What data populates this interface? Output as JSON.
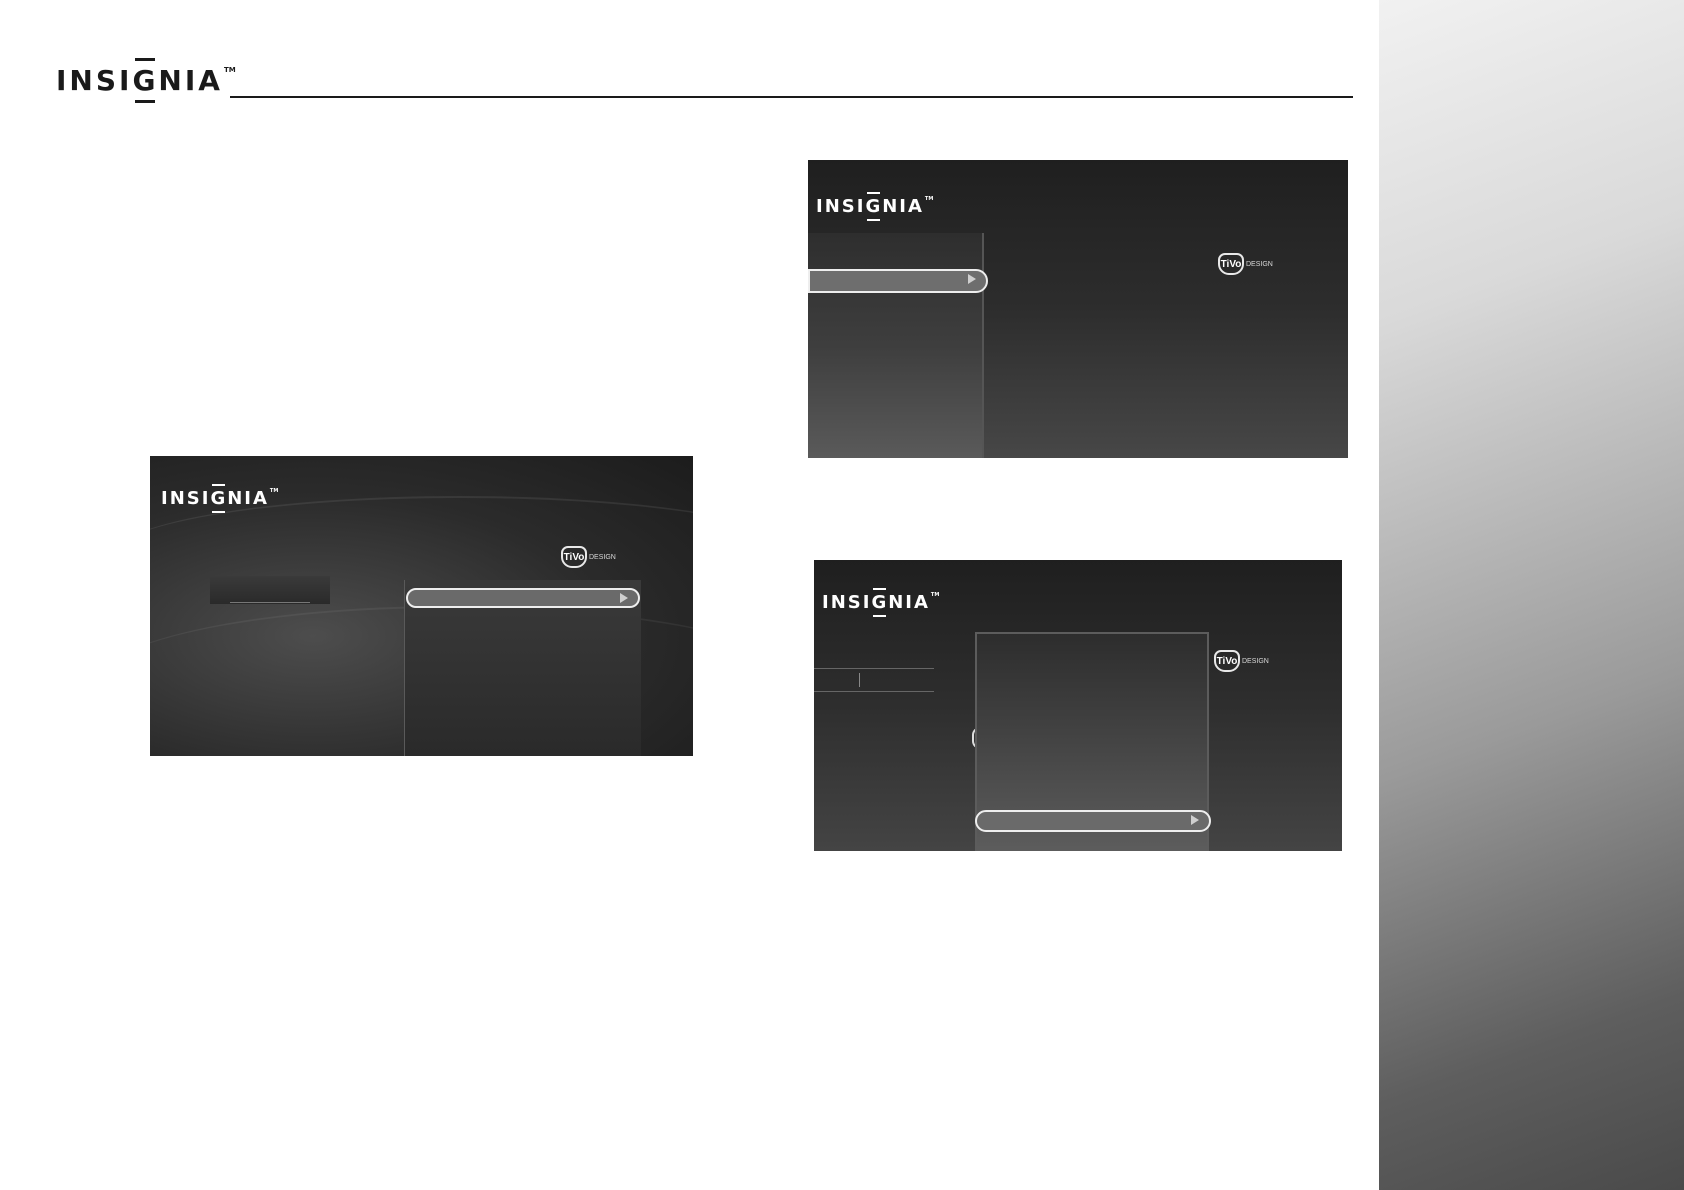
{
  "header": {
    "logo_text_pre": "INSI",
    "logo_text_g": "G",
    "logo_text_post": "NIA",
    "trademark": "TM"
  },
  "screens": {
    "a": {
      "logo_pre": "INSI",
      "logo_g": "G",
      "logo_post": "NIA",
      "tm": "TM",
      "tivo": "TiVo",
      "tivo_suffix": "DESIGN"
    },
    "b": {
      "logo_pre": "INSI",
      "logo_g": "G",
      "logo_post": "NIA",
      "tm": "TM",
      "tivo": "TiVo",
      "tivo_suffix": "DESIGN"
    },
    "c": {
      "logo_pre": "INSI",
      "logo_g": "G",
      "logo_post": "NIA",
      "tm": "TM",
      "tivo": "TiVo",
      "tivo_suffix": "DESIGN"
    }
  },
  "colors": {
    "rule": "#1a1a1a",
    "screen_bg_dark": "#1f1f1f",
    "highlight_border": "#eeeeee"
  }
}
